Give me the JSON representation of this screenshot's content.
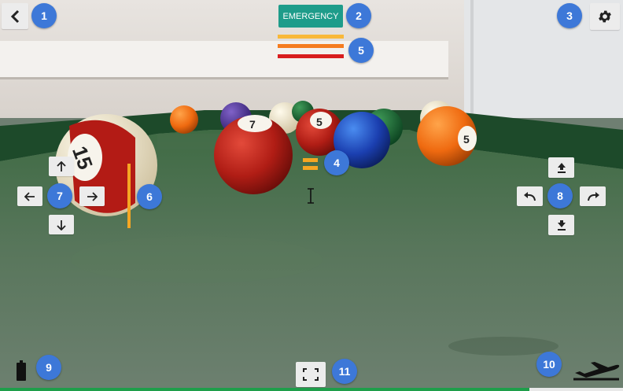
{
  "app": {
    "emergency_label": "EMERGENCY",
    "colors": {
      "emergency": "#1e9c8a",
      "accent_orange": "#f5a623",
      "level_yellow": "#f9b839",
      "level_orange": "#f57c1f",
      "level_red": "#d81e1e",
      "badge_blue": "#3d78d8",
      "button_bg": "#ececec",
      "progress_green": "#1e9e4a"
    }
  },
  "icons": {
    "back": "chevron-left-icon",
    "settings": "gear-icon",
    "up": "arrow-up-icon",
    "down": "arrow-down-icon",
    "left": "arrow-left-icon",
    "right": "arrow-right-icon",
    "ascend": "upload-icon",
    "descend": "download-icon",
    "rotate_left": "undo-icon",
    "rotate_right": "redo-icon",
    "fullscreen": "fullscreen-icon",
    "battery": "battery-icon",
    "flight_mode": "airplane-takeoff-icon",
    "cursor": "text-cursor-icon"
  },
  "status": {
    "levels": [
      "yellow",
      "orange",
      "red"
    ],
    "progress_fraction": 0.85
  },
  "badges": [
    "1",
    "2",
    "3",
    "4",
    "5",
    "6",
    "7",
    "8",
    "9",
    "10",
    "11"
  ]
}
